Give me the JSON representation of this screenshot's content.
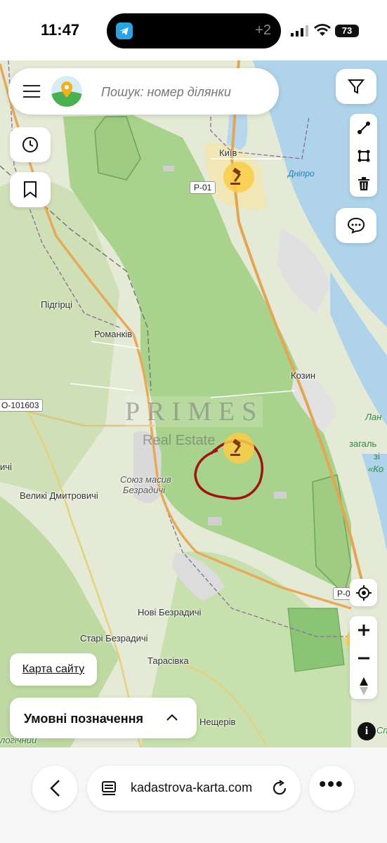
{
  "status_bar": {
    "time": "11:47",
    "notification_count": "+2",
    "battery": "73"
  },
  "search": {
    "placeholder": "Пошук: номер ділянки"
  },
  "map": {
    "places": {
      "kyiv": "Київ",
      "pidhirtsi": "Підгірці",
      "romankiv": "Романків",
      "kozyn": "Козин",
      "velyki_dmytrovychi": "Великі Дмитровичі",
      "nevi_bezradychi": "Нові Безрадичі",
      "stari_bezradychi": "Старі Безрадичі",
      "tarasivka": "Тарасівка",
      "nescheriv": "Нещерів",
      "soyuz": "Союз масив",
      "bezradychi": "Безрадичі",
      "edge_chi": "ичі",
      "edge_lan": "Лан",
      "edge_zahal": "загаль",
      "edge_zi": "зі",
      "edge_ko": "«Ко",
      "edge_logichnyi": "логічний",
      "edge_sp": "Сп"
    },
    "water": {
      "dnipro": "Дніпро"
    },
    "roads": {
      "r01_top": "Р-01",
      "r01_right": "Р-0",
      "o101603": "О-101603"
    },
    "watermark": {
      "title": "PRIMES",
      "subtitle": "Real Estate"
    }
  },
  "buttons": {
    "sitemap": "Карта сайту",
    "legend": "Умовні позначення",
    "info": "i"
  },
  "browser": {
    "url": "kadastrova-karta.com"
  },
  "colors": {
    "forest": "#a9d28c",
    "water": "#a9cfe6",
    "marker": "#f5c842",
    "annotation": "#a01414"
  }
}
